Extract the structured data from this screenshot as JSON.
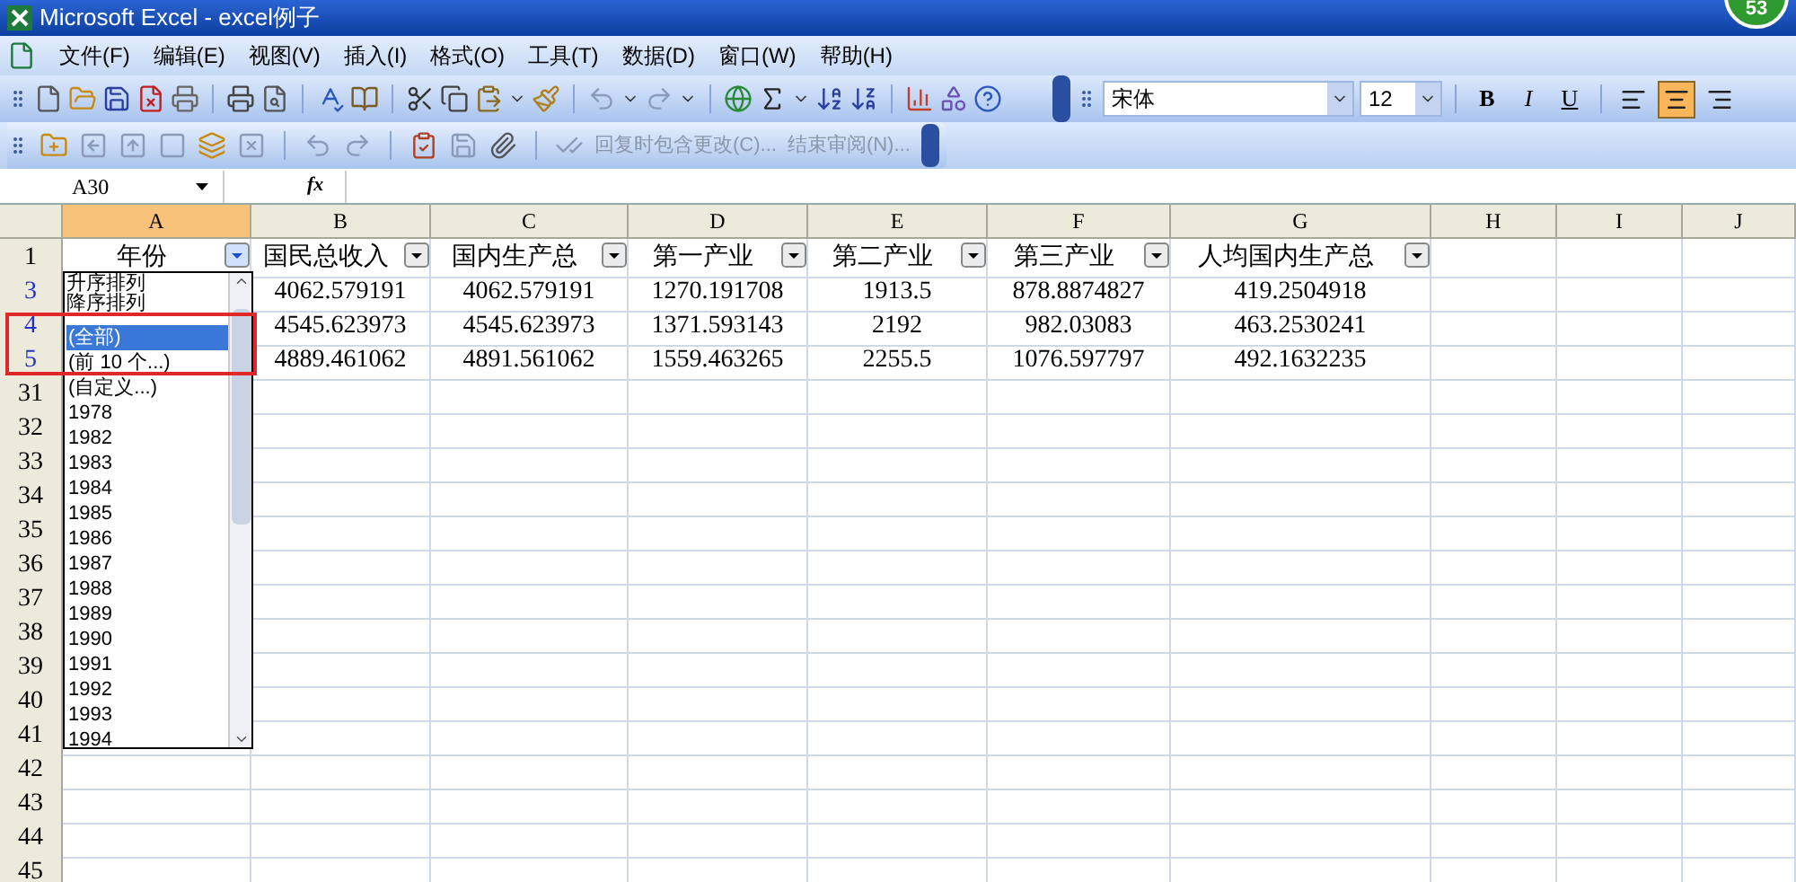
{
  "window": {
    "title": "Microsoft Excel - excel例子",
    "badge": "53"
  },
  "menu": [
    "文件(F)",
    "编辑(E)",
    "视图(V)",
    "插入(I)",
    "格式(O)",
    "工具(T)",
    "数据(D)",
    "窗口(W)",
    "帮助(H)"
  ],
  "formatting": {
    "font": "宋体",
    "size": "12",
    "styles": [
      {
        "kind": "bold",
        "label": "B"
      },
      {
        "kind": "italic",
        "label": "I"
      },
      {
        "kind": "underline",
        "label": "U"
      }
    ],
    "align": [
      {
        "kind": "left",
        "selected": false
      },
      {
        "kind": "center",
        "selected": true
      },
      {
        "kind": "right",
        "selected": false
      }
    ]
  },
  "reviewing": [
    "回复时包含更改(C)...",
    "结束审阅(N)..."
  ],
  "formula_bar": {
    "name_box": "A30",
    "fx": "fx"
  },
  "sheet": {
    "columns": [
      {
        "label": "A",
        "selected": true
      },
      {
        "label": "B",
        "selected": false
      },
      {
        "label": "C",
        "selected": false
      },
      {
        "label": "D",
        "selected": false
      },
      {
        "label": "E",
        "selected": false
      },
      {
        "label": "F",
        "selected": false
      },
      {
        "label": "G",
        "selected": false
      },
      {
        "label": "H",
        "selected": false
      },
      {
        "label": "I",
        "selected": false
      },
      {
        "label": "J",
        "selected": false
      }
    ],
    "header_row": {
      "label": "1",
      "cells": [
        {
          "text": "年份",
          "filter_active": true
        },
        {
          "text": "国民总收入",
          "filter_active": false
        },
        {
          "text": "国内生产总",
          "filter_active": false
        },
        {
          "text": "第一产业",
          "filter_active": false
        },
        {
          "text": "第二产业",
          "filter_active": false
        },
        {
          "text": "第三产业",
          "filter_active": false
        },
        {
          "text": "人均国内生产总",
          "filter_active": false
        }
      ]
    },
    "rows": [
      {
        "label": "3",
        "filtered": true,
        "values": [
          "4062.579191",
          "4062.579191",
          "1270.191708",
          "1913.5",
          "878.8874827",
          "419.2504918"
        ]
      },
      {
        "label": "4",
        "filtered": true,
        "values": [
          "4545.623973",
          "4545.623973",
          "1371.593143",
          "2192",
          "982.03083",
          "463.2530241"
        ]
      },
      {
        "label": "5",
        "filtered": true,
        "values": [
          "4889.461062",
          "4891.561062",
          "1559.463265",
          "2255.5",
          "1076.597797",
          "492.1632235"
        ]
      },
      {
        "label": "31",
        "filtered": false
      },
      {
        "label": "32",
        "filtered": false
      },
      {
        "label": "33",
        "filtered": false
      },
      {
        "label": "34",
        "filtered": false
      },
      {
        "label": "35",
        "filtered": false
      },
      {
        "label": "36",
        "filtered": false
      },
      {
        "label": "37",
        "filtered": false
      },
      {
        "label": "38",
        "filtered": false
      },
      {
        "label": "39",
        "filtered": false
      },
      {
        "label": "40",
        "filtered": false
      },
      {
        "label": "41",
        "filtered": false
      },
      {
        "label": "42",
        "filtered": false
      },
      {
        "label": "43",
        "filtered": false
      },
      {
        "label": "44",
        "filtered": false
      },
      {
        "label": "45",
        "filtered": false
      }
    ]
  },
  "filter_dropdown": {
    "sort": [
      "升序排列",
      "降序排列"
    ],
    "items": [
      {
        "text": "(全部)",
        "selected": true
      },
      {
        "text": "(前 10 个...)",
        "selected": false
      },
      {
        "text": "(自定义...)",
        "selected": false
      },
      {
        "text": "1978",
        "selected": false
      },
      {
        "text": "1982",
        "selected": false
      },
      {
        "text": "1983",
        "selected": false
      },
      {
        "text": "1984",
        "selected": false
      },
      {
        "text": "1985",
        "selected": false
      },
      {
        "text": "1986",
        "selected": false
      },
      {
        "text": "1987",
        "selected": false
      },
      {
        "text": "1988",
        "selected": false
      },
      {
        "text": "1989",
        "selected": false
      },
      {
        "text": "1990",
        "selected": false
      },
      {
        "text": "1991",
        "selected": false
      },
      {
        "text": "1992",
        "selected": false
      },
      {
        "text": "1993",
        "selected": false
      },
      {
        "text": "1994",
        "selected": false
      }
    ]
  }
}
